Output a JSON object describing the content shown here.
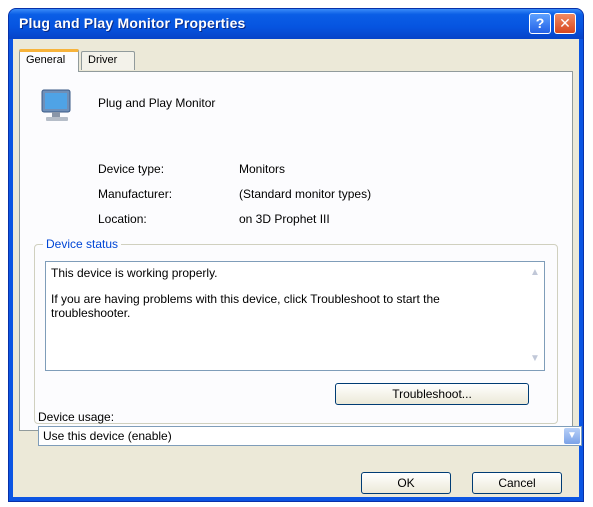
{
  "window": {
    "title": "Plug and Play Monitor Properties",
    "help_glyph": "?",
    "close_glyph": "✕"
  },
  "tabs": [
    {
      "label": "General",
      "active": true
    },
    {
      "label": "Driver",
      "active": false
    }
  ],
  "device": {
    "icon": "monitor-icon",
    "name": "Plug and Play Monitor"
  },
  "properties": [
    {
      "label": "Device type:",
      "value": "Monitors"
    },
    {
      "label": "Manufacturer:",
      "value": "(Standard monitor types)"
    },
    {
      "label": "Location:",
      "value": "on 3D Prophet III"
    }
  ],
  "device_status": {
    "title": "Device status",
    "line1": "This device is working properly.",
    "line2": "If you are having problems with this device, click Troubleshoot to start the troubleshooter.",
    "troubleshoot_label": "Troubleshoot..."
  },
  "device_usage": {
    "label": "Device usage:",
    "selected": "Use this device (enable)"
  },
  "buttons": {
    "ok": "OK",
    "cancel": "Cancel"
  },
  "colors": {
    "titlebar": "#0654e0",
    "client": "#ece9d8",
    "group_title": "#0046d5"
  }
}
